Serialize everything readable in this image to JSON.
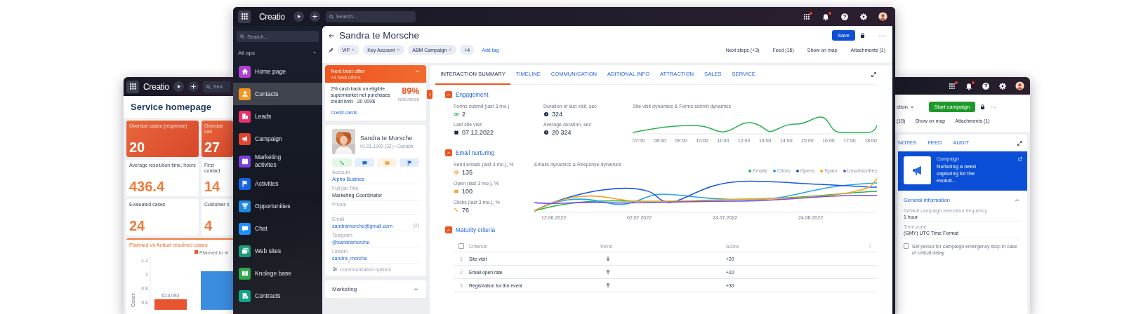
{
  "service_window": {
    "top_bar": {
      "logo": "Creatio",
      "search": {
        "placeholder": "Sea"
      }
    },
    "title": "Service homepage",
    "tiles": [
      {
        "kind": "alert",
        "label": "Overdue cases (response)",
        "value": "20"
      },
      {
        "kind": "alert",
        "label": "Overdue cas",
        "value": "27"
      },
      {
        "kind": "plain",
        "label": "Average resolution time, hours",
        "value": "436.4"
      },
      {
        "kind": "plain",
        "label": "First contact",
        "value": "14"
      },
      {
        "kind": "plain",
        "label": "Evaluated cases",
        "value": "24"
      },
      {
        "kind": "plain",
        "label": "Customer s",
        "value": "4"
      }
    ],
    "chart": {
      "title": "Planned vs Actual resolved cases",
      "bar_label": "613 092",
      "chart_data": {
        "type": "bar",
        "categories": [
          null
        ],
        "ylabel": "Cases",
        "ylim": [
          0.5,
          1.25
        ],
        "yticks": [
          0.6,
          0.8,
          1,
          1.2
        ],
        "series": [
          {
            "name": "Planned to re",
            "color": "#e8542f",
            "values": [
              0.65
            ]
          },
          {
            "color": "#3b8de0",
            "values": [
              1.05
            ]
          }
        ]
      }
    }
  },
  "campaign_window": {
    "icons": [
      {
        "kind": "apps",
        "badge": true
      },
      {
        "kind": "bell",
        "badge": true
      },
      {
        "kind": "help",
        "badge": false
      },
      {
        "kind": "gear",
        "badge": false
      },
      {
        "kind": "avatar",
        "badge": false
      }
    ],
    "view_label": "ction",
    "start": "Start campaign",
    "links": [
      "(15)",
      "Show on map",
      "Attachments (1)"
    ],
    "tabs": [
      {
        "label": "NOTES",
        "selected": false
      },
      {
        "label": "FEED",
        "selected": false
      },
      {
        "label": "AUDIT",
        "selected": false
      }
    ],
    "campaign": {
      "type": "Campaign",
      "title": "Nurturing a need capturing for the evoluti..."
    },
    "general": {
      "title": "General information",
      "expanded": true,
      "fields": [
        {
          "label": "Default campaign execution frequency",
          "value": "1 hour"
        },
        {
          "label": "Time zone",
          "value": "(GMY) UTC Time Format"
        }
      ],
      "option": {
        "label": "Set period for campaign emergency stop in case of critical delay",
        "checked": false
      }
    }
  },
  "contact_window": {
    "top_bar": {
      "logo": "Creatio",
      "search": {
        "placeholder": "Search..."
      },
      "icons": [
        {
          "kind": "apps",
          "badge": true
        },
        {
          "kind": "bell",
          "badge": true
        },
        {
          "kind": "help",
          "badge": false
        },
        {
          "kind": "gear",
          "badge": false
        },
        {
          "kind": "avatar",
          "badge": false
        }
      ]
    },
    "sidebar": {
      "search": {
        "placeholder": "Search..."
      },
      "filter": "All aps",
      "items": [
        {
          "label": "Home page",
          "kind": "home",
          "color": "#b23fd3",
          "selected": false
        },
        {
          "label": "Contacts",
          "kind": "person",
          "color": "#f7941d",
          "selected": true
        },
        {
          "label": "Leads",
          "kind": "building",
          "color": "#e8336d",
          "selected": false
        },
        {
          "label": "Campaign",
          "kind": "megaphone",
          "color": "#e8432e",
          "selected": false
        },
        {
          "label": "Marketing activites",
          "kind": "calendar",
          "color": "#7b3fe4",
          "selected": false
        },
        {
          "label": "Activities",
          "kind": "flag",
          "color": "#1565e0",
          "selected": false
        },
        {
          "label": "Opportunities",
          "kind": "funnel",
          "color": "#1e88e5",
          "selected": false
        },
        {
          "label": "Chat",
          "kind": "chat",
          "color": "#1e90ff",
          "selected": false
        },
        {
          "label": "Web sites",
          "kind": "window",
          "color": "#1a9a7a",
          "selected": false
        },
        {
          "label": "Knolege base",
          "kind": "book",
          "color": "#2ea84a",
          "selected": false
        },
        {
          "label": "Contracts",
          "kind": "document",
          "color": "#14a38b",
          "selected": false
        }
      ]
    },
    "record": {
      "title": "Sandra te Morsche",
      "tags": [
        {
          "label": "VIP",
          "removable": true
        },
        {
          "label": "Key Account",
          "removable": true
        },
        {
          "label": "ABM Campaign",
          "removable": true
        },
        {
          "label": "+4",
          "removable": false
        }
      ],
      "add_tag": "Add tag",
      "save": "Save",
      "links": [
        "Next steps (+3)",
        "Feed (15)",
        "Show on map",
        "Attachments (1)"
      ]
    },
    "offer": {
      "title": "Next best offer",
      "subtitle": "+4 best offers",
      "expanded": true,
      "text": "2% cash back on eligible supermarket net purchases credit limit - 20 000$",
      "score": "89%",
      "score_label": "relevance",
      "link": "Credit cards"
    },
    "contact": {
      "name": "Sandra te Morsche",
      "meta": "01.01.1990 (32) • Canada",
      "actions": [
        {
          "kind": "phone"
        },
        {
          "kind": "chat"
        },
        {
          "kind": "mail"
        },
        {
          "kind": "flag"
        }
      ],
      "fields": [
        {
          "label": "Account",
          "value": "Alpha Busines",
          "kind": "link"
        },
        {
          "label": "Full job Title",
          "value": "Marketing Coordinator",
          "kind": "text"
        },
        {
          "label": "Phone"
        },
        {
          "label": "Email",
          "value": "sandramorche@gmail.com",
          "count": "(2)",
          "kind": "link"
        },
        {
          "label": "Telegram",
          "value": "@sandramorche",
          "kind": "link"
        },
        {
          "label": "Linkdin",
          "value": "sandra_morche",
          "kind": "link"
        }
      ],
      "options": "Communication options"
    },
    "marketing": {
      "title": "Marketing",
      "expanded": true
    },
    "panel": {
      "tabs": [
        {
          "label": "INTERACTION SUMMARY",
          "selected": true
        },
        {
          "label": "TIMELINE",
          "selected": false
        },
        {
          "label": "COMMUNICATION",
          "selected": false
        },
        {
          "label": "ADITIONAL INFO",
          "selected": false
        },
        {
          "label": "ATTRACTION",
          "selected": false
        },
        {
          "label": "SALES",
          "selected": false
        },
        {
          "label": "SERVICE",
          "selected": false
        }
      ],
      "engagement": {
        "title": "Engagement",
        "expanded": true,
        "metrics": [
          {
            "label": "Forms submit (last 3 mo.)",
            "value": "2",
            "kind": "link"
          },
          {
            "label": "Duration of last visit, sec",
            "value": "324",
            "kind": "clock"
          },
          {
            "label": "Last site visit",
            "value": "07.12.2022",
            "kind": "calendar"
          },
          {
            "label": "Average duration, sec",
            "value": "20 324",
            "kind": "clock"
          }
        ],
        "chart": {
          "title": "Site visit dynamics & Forms submit dynamics",
          "x_labels": [
            "07:00",
            "08:00",
            "09:00",
            "10:00",
            "11:00",
            "12:00",
            "13:00",
            "14:00",
            "15:00",
            "16:00",
            "17:00",
            "18:00"
          ]
        }
      },
      "email": {
        "title": "Email nurturing",
        "expanded": true,
        "metrics": [
          {
            "label": "Send emails (last 3 mo.), %",
            "value": "135",
            "kind": "at"
          },
          {
            "label": "Open (last 3 mo.), %",
            "value": "100",
            "kind": "mail"
          },
          {
            "label": "Clicks (last 3 mo.), %",
            "value": "76",
            "kind": "click"
          }
        ],
        "chart": {
          "title": "Emails dynamics & Response dynamics",
          "legend": [
            {
              "label": "Emails",
              "color": "#2bb24c"
            },
            {
              "label": "Clicks",
              "color": "#1ea7f0"
            },
            {
              "label": "Opens",
              "color": "#1a56e8"
            },
            {
              "label": "Spam",
              "color": "#f5a623"
            },
            {
              "label": "Unsubscribes",
              "color": "#7b4fe0"
            }
          ],
          "x_labels": [
            "12.06.2022",
            "02.07.2022",
            "24.07.2022",
            "24.08.2022"
          ]
        }
      },
      "maturity": {
        "title": "Maturity criteria",
        "expanded": true,
        "select_all": {
          "checked": false
        },
        "columns": [
          "Criterion",
          "Trend",
          "Score"
        ],
        "rows": [
          {
            "number": "1",
            "criterion": "Site visit",
            "kind": "down",
            "score": "+20"
          },
          {
            "number": "2",
            "criterion": "Email open rate",
            "kind": "up",
            "score": "+10"
          },
          {
            "number": "3",
            "criterion": "Registration for the event",
            "kind": "up",
            "score": "+30"
          }
        ]
      }
    }
  }
}
